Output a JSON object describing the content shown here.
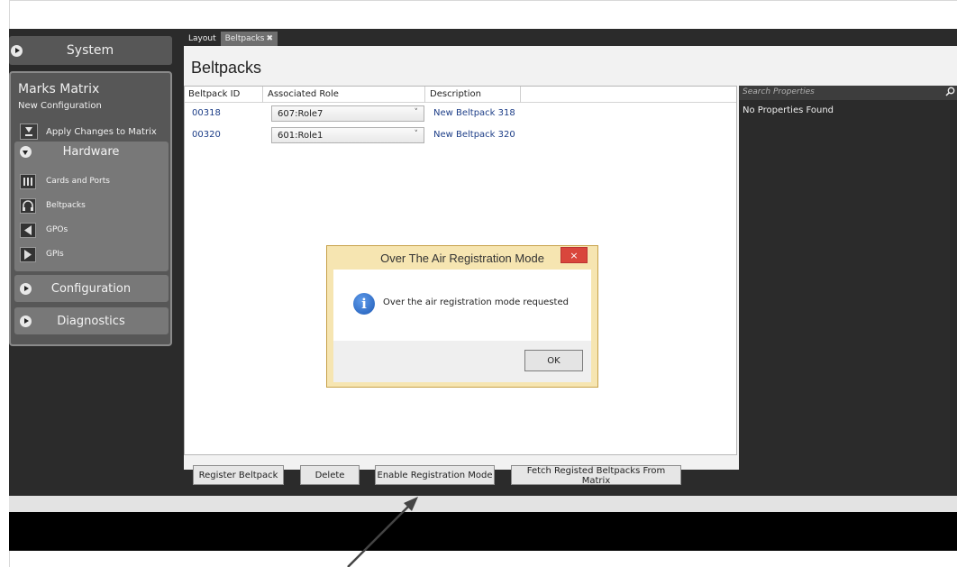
{
  "tabs": [
    {
      "label": "Layout"
    },
    {
      "label": "Beltpacks",
      "close": "✖"
    }
  ],
  "nav": {
    "system_label": "System",
    "panel_title": "Marks Matrix",
    "panel_subtitle": "New Configuration",
    "apply_label": "Apply Changes to Matrix",
    "hardware_label": "Hardware",
    "hardware_items": [
      {
        "label": "Cards and Ports",
        "icon": "cards-icon"
      },
      {
        "label": "Beltpacks",
        "icon": "headset-icon"
      },
      {
        "label": "GPOs",
        "icon": "gpo-icon"
      },
      {
        "label": "GPIs",
        "icon": "gpi-icon"
      }
    ],
    "configuration_label": "Configuration",
    "diagnostics_label": "Diagnostics"
  },
  "main": {
    "title": "Beltpacks",
    "columns": [
      "Beltpack ID",
      "Associated Role",
      "Description"
    ],
    "rows": [
      {
        "id": "00318",
        "role": "607:Role7",
        "description": "New Beltpack 318"
      },
      {
        "id": "00320",
        "role": "601:Role1",
        "description": "New Beltpack 320"
      }
    ],
    "buttons": {
      "register": "Register Beltpack",
      "delete": "Delete",
      "enable": "Enable Registration Mode",
      "fetch": "Fetch Registed Beltpacks From Matrix"
    }
  },
  "properties": {
    "search_placeholder": "Search Properties",
    "empty_text": "No Properties Found"
  },
  "dialog": {
    "title": "Over The Air Registration Mode",
    "close": "×",
    "message": "Over the air registration mode requested",
    "ok_label": "OK",
    "icon": "info-icon"
  },
  "colors": {
    "link_blue": "#1c3d87",
    "dialog_frame": "#f6e5b1",
    "close_red": "#d9463c",
    "nav_dark": "#2b2b2b"
  }
}
